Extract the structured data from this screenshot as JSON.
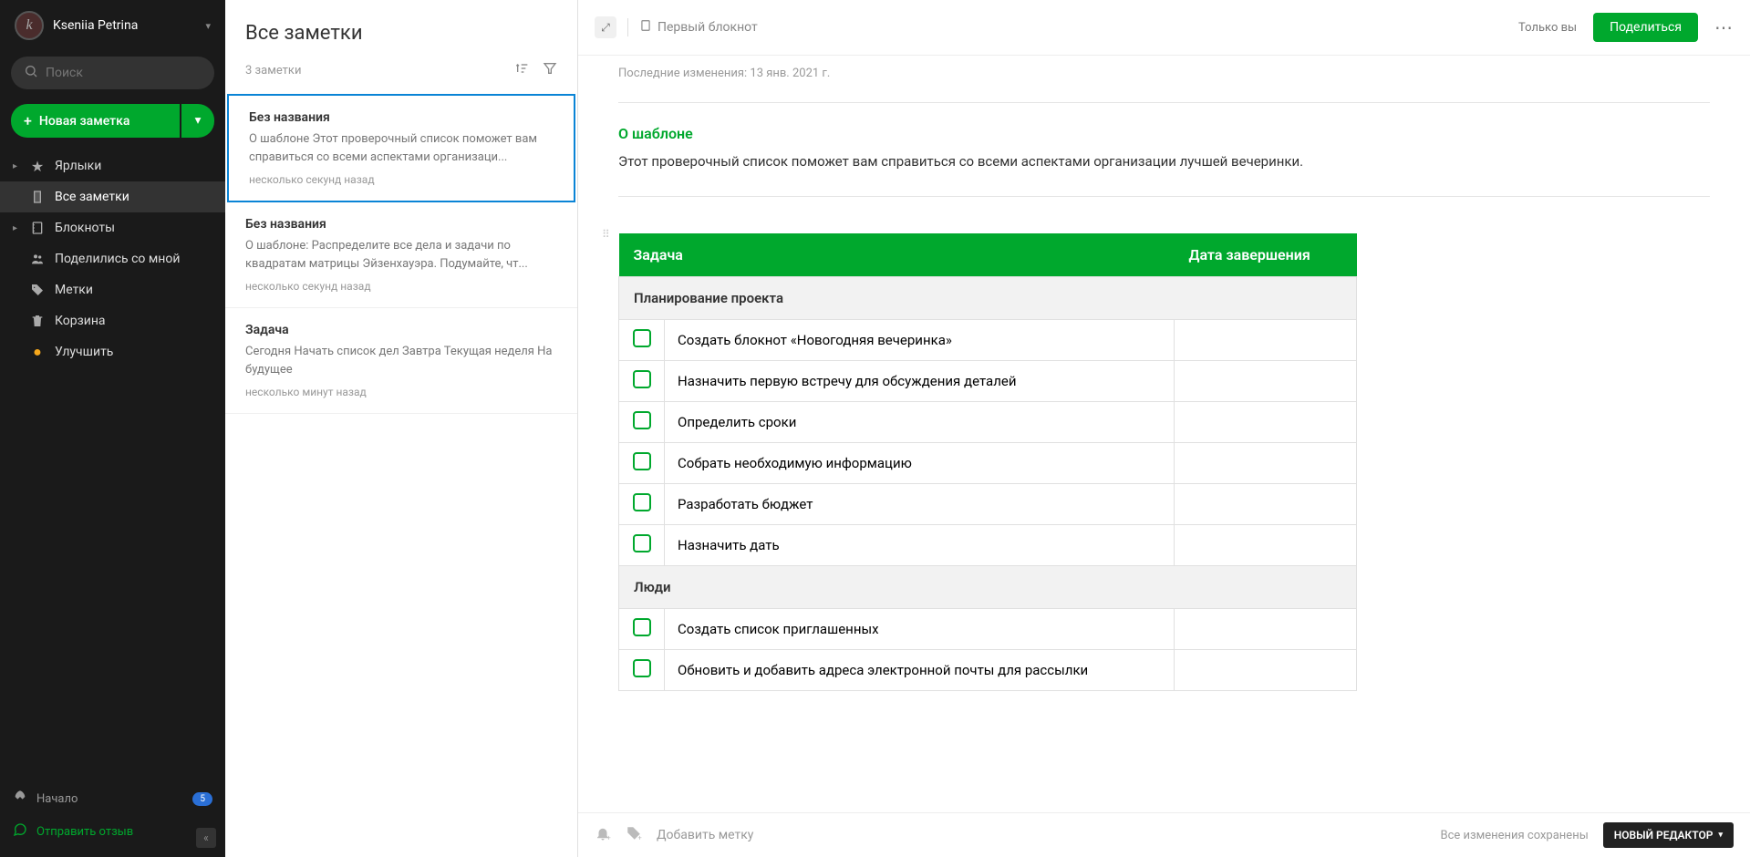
{
  "user": {
    "name": "Kseniia Petrina",
    "initial": "k"
  },
  "search": {
    "placeholder": "Поиск"
  },
  "newNote": {
    "label": "Новая заметка"
  },
  "nav": {
    "shortcuts": "Ярлыки",
    "allNotes": "Все заметки",
    "notebooks": "Блокноты",
    "shared": "Поделились со мной",
    "tags": "Метки",
    "trash": "Корзина",
    "upgrade": "Улучшить"
  },
  "bottom": {
    "start": "Начало",
    "startBadge": "5",
    "feedback": "Отправить отзыв"
  },
  "listPanel": {
    "title": "Все заметки",
    "count": "3 заметки",
    "notes": [
      {
        "title": "Без названия",
        "preview": "О шаблоне Этот проверочный список поможет вам справиться со всеми аспектами организаци...",
        "time": "несколько секунд назад"
      },
      {
        "title": "Без названия",
        "preview": "О шаблоне: Распределите все дела и задачи по квадратам матрицы Эйзенхауэра. Подумайте, чт...",
        "time": "несколько секунд назад"
      },
      {
        "title": "Задача",
        "preview": "Сегодня Начать список дел Завтра Текущая неделя На будущее",
        "time": "несколько минут назад"
      }
    ]
  },
  "editor": {
    "notebook": "Первый блокнот",
    "onlyYou": "Только вы",
    "share": "Поделиться",
    "lastEdit": "Последние изменения: 13 янв. 2021 г.",
    "aboutHeading": "О шаблоне",
    "aboutText": "Этот проверочный список поможет вам справиться со всеми аспектами организации лучшей вечеринки.",
    "table": {
      "headers": {
        "task": "Задача",
        "date": "Дата завершения"
      },
      "sections": [
        {
          "title": "Планирование проекта",
          "rows": [
            "Создать блокнот «Новогодняя вечеринка»",
            "Назначить первую встречу для обсуждения деталей",
            "Определить сроки",
            "Собрать необходимую информацию",
            "Разработать бюджет",
            "Назначить дать"
          ]
        },
        {
          "title": "Люди",
          "rows": [
            "Создать список приглашенных",
            "Обновить и добавить адреса электронной почты для рассылки"
          ]
        }
      ]
    },
    "footer": {
      "addTag": "Добавить метку",
      "saved": "Все изменения сохранены",
      "newEditor": "НОВЫЙ РЕДАКТОР"
    }
  }
}
